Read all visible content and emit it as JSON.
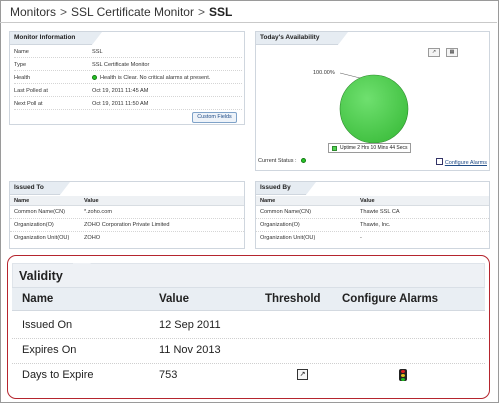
{
  "breadcrumb": {
    "items": [
      "Monitors",
      "SSL Certificate Monitor",
      "SSL"
    ],
    "separator": ">"
  },
  "monitor_info": {
    "title": "Monitor Information",
    "rows": [
      {
        "label": "Name",
        "value": "SSL"
      },
      {
        "label": "Type",
        "value": "SSL Certificate Monitor"
      },
      {
        "label": "Health",
        "value": "Health is Clear. No critical alarms at present."
      },
      {
        "label": "Last Polled at",
        "value": "Oct 19, 2011 11:45 AM"
      },
      {
        "label": "Next Poll at",
        "value": "Oct 19, 2011 11:50 AM"
      }
    ],
    "custom_fields_label": "Custom Fields"
  },
  "availability": {
    "title": "Today's Availability",
    "percent_label": "100.00%",
    "legend": "Uptime 2 Hrs 10 Mins 44 Secs",
    "current_status_label": "Current Status :",
    "configure_alarms_label": "Configure Alarms",
    "up_color": "#53d253"
  },
  "issued_to": {
    "title": "Issued To",
    "headers": [
      "Name",
      "Value"
    ],
    "rows": [
      [
        "Common Name(CN)",
        "*.zoho.com"
      ],
      [
        "Organization(O)",
        "ZOHO Corporation Private Limited"
      ],
      [
        "Organization Unit(OU)",
        "ZOHO"
      ]
    ]
  },
  "issued_by": {
    "title": "Issued By",
    "headers": [
      "Name",
      "Value"
    ],
    "rows": [
      [
        "Common Name(CN)",
        "Thawte SSL CA"
      ],
      [
        "Organization(O)",
        "Thawte, Inc."
      ],
      [
        "Organization Unit(OU)",
        "-"
      ]
    ]
  },
  "validity": {
    "title": "Validity",
    "headers": [
      "Name",
      "Value",
      "Threshold",
      "Configure Alarms"
    ],
    "rows": [
      {
        "name": "Issued On",
        "value": "12 Sep 2011"
      },
      {
        "name": "Expires On",
        "value": "11 Nov 2013"
      },
      {
        "name": "Days to Expire",
        "value": "753"
      }
    ],
    "border_color": "#b5252e"
  }
}
